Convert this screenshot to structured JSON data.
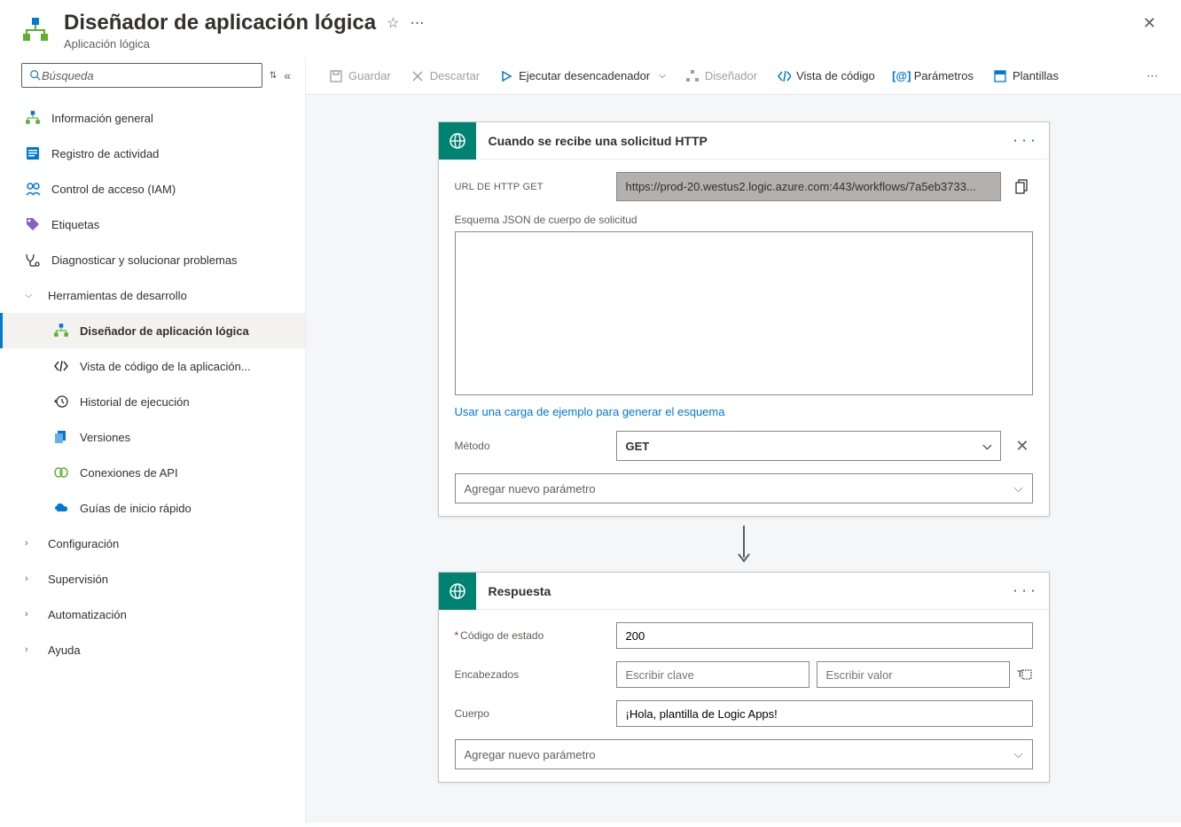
{
  "header": {
    "title": "Diseñador de aplicación lógica",
    "subtitle": "Aplicación lógica"
  },
  "search": {
    "placeholder": "Búsqueda"
  },
  "nav": {
    "overview": "Información general",
    "activity": "Registro de actividad",
    "iam": "Control de acceso (IAM)",
    "tags": "Etiquetas",
    "diagnose": "Diagnosticar y solucionar problemas",
    "devtools": "Herramientas de desarrollo",
    "designer": "Diseñador de aplicación lógica",
    "codeview": "Vista de código de la aplicación...",
    "history": "Historial de ejecución",
    "versions": "Versiones",
    "apiconn": "Conexiones de API",
    "quickstart": "Guías de inicio rápido",
    "config": "Configuración",
    "supervision": "Supervisión",
    "automation": "Automatización",
    "help": "Ayuda"
  },
  "toolbar": {
    "save": "Guardar",
    "discard": "Descartar",
    "runtrigger": "Ejecutar desencadenador",
    "designer": "Diseñador",
    "codeview": "Vista de código",
    "parameters": "Parámetros",
    "templates": "Plantillas"
  },
  "trigger": {
    "title": "Cuando se recibe una solicitud HTTP",
    "url_label": "URL DE HTTP GET",
    "url_value": "https://prod-20.westus2.logic.azure.com:443/workflows/7a5eb3733...",
    "schema_label": "Esquema JSON de cuerpo de solicitud",
    "sample_link": "Usar una carga de ejemplo para generar el esquema",
    "method_label": "Método",
    "method_value": "GET",
    "addparam": "Agregar nuevo parámetro"
  },
  "response": {
    "title": "Respuesta",
    "status_label": "Código de estado",
    "status_value": "200",
    "headers_label": "Encabezados",
    "key_placeholder": "Escribir clave",
    "value_placeholder": "Escribir valor",
    "body_label": "Cuerpo",
    "body_value": "¡Hola, plantilla de Logic Apps!",
    "addparam": "Agregar nuevo parámetro"
  }
}
